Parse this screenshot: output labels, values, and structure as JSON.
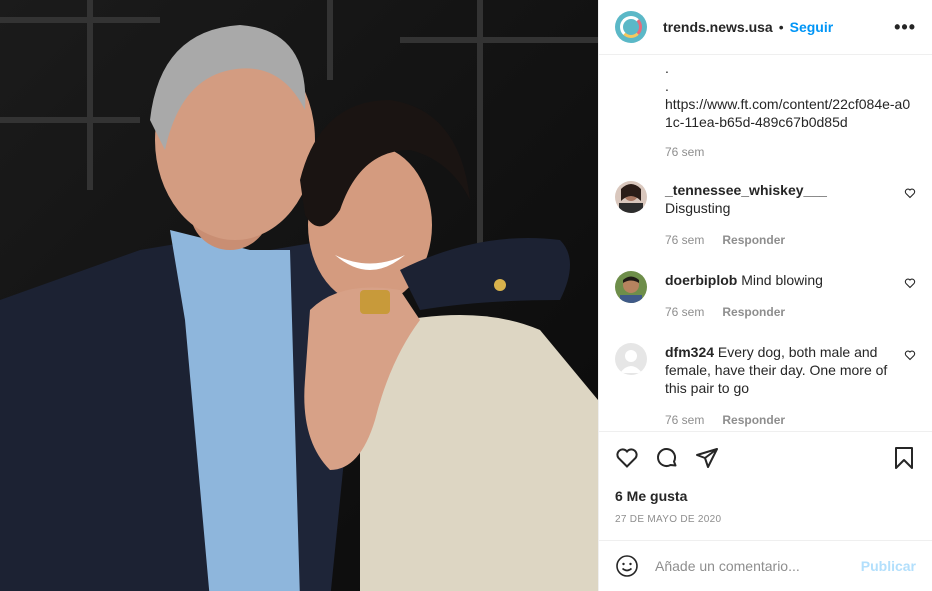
{
  "header": {
    "username": "trends.news.usa",
    "separator": "•",
    "follow_label": "Seguir",
    "more_label": "•••"
  },
  "caption": {
    "lines": [
      ".",
      ".",
      "https://www.ft.com/content/22cf084e-a01c-11ea-b65d-489c67b0d85d"
    ],
    "time": "76 sem"
  },
  "comments": [
    {
      "user": "_tennessee_whiskey___",
      "text": "Disgusting",
      "time": "76 sem",
      "reply": "Responder"
    },
    {
      "user": "doerbiplob",
      "text": "Mind blowing",
      "time": "76 sem",
      "reply": "Responder"
    },
    {
      "user": "dfm324",
      "text": "Every dog, both male and female, have their day. One more of this pair to go",
      "time": "76 sem",
      "reply": "Responder"
    }
  ],
  "actions": {
    "likes": "6 Me gusta",
    "date": "27 DE MAYO DE 2020"
  },
  "add_comment": {
    "placeholder": "Añade un comentario...",
    "publish_label": "Publicar"
  },
  "icons": [
    "smiley-icon",
    "heart-icon",
    "comment-icon",
    "share-icon",
    "bookmark-icon"
  ],
  "colors": {
    "link": "#0095f6",
    "publish_disabled": "#b2dffc",
    "muted": "#8e8e8e"
  }
}
